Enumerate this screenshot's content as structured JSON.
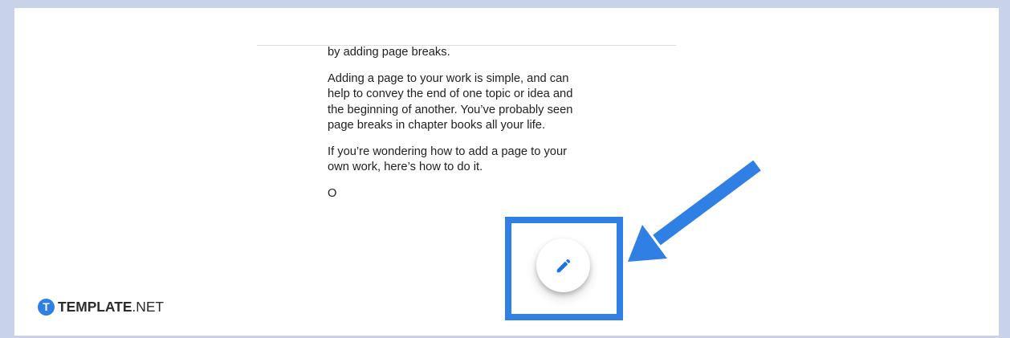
{
  "colors": {
    "frame": "#c8d2e8",
    "page": "#ffffff",
    "text": "#202124",
    "accent": "#2f7fe4",
    "icon": "#1a73e8"
  },
  "document": {
    "paragraphs": [
      {
        "lines": [
          "by adding page breaks."
        ]
      },
      {
        "lines": [
          "Adding a page to your work is simple, and can",
          "help to convey the end of one topic or idea and",
          "the beginning of another. You’ve probably seen",
          "page breaks in chapter books all your life."
        ]
      },
      {
        "lines": [
          "If you’re wondering how to add a page to your",
          "own work, here’s how to do it."
        ]
      },
      {
        "lines": [
          "O"
        ]
      }
    ]
  },
  "edit_button": {
    "icon": "pencil-icon"
  },
  "logo": {
    "mark": "T",
    "brand": "TEMPLATE",
    "suffix": ".NET"
  }
}
